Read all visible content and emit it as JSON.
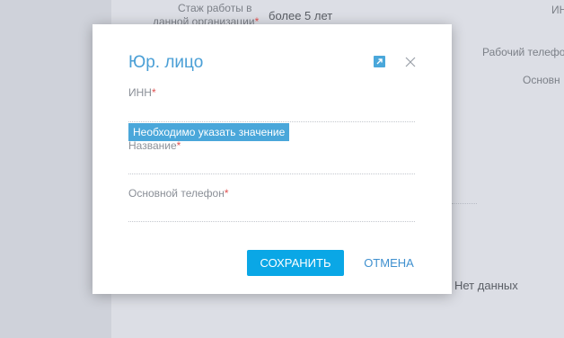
{
  "background": {
    "experience_label_line1": "Стаж работы в",
    "experience_label_line2": "данной организации",
    "experience_value": "более 5 лет",
    "inn_label_partial": "ИН",
    "work_phone_label": "Рабочий телефо",
    "main_label_partial": "Основн",
    "no_data": "Нет данных"
  },
  "modal": {
    "title": "Юр. лицо",
    "maximize_icon": "external-link-icon",
    "close_icon": "close-icon",
    "fields": [
      {
        "label": "ИНН",
        "required_mark": "*",
        "value": ""
      },
      {
        "label": "Название",
        "required_mark": "*",
        "value": ""
      },
      {
        "label": "Основной телефон",
        "required_mark": "*",
        "value": ""
      }
    ],
    "validation_tooltip": "Необходимо указать значение",
    "save_label": "СОХРАНИТЬ",
    "cancel_label": "ОТМЕНА"
  },
  "colors": {
    "accent": "#4aa7da",
    "save_button": "#0aa7e6",
    "required": "#e05252"
  }
}
